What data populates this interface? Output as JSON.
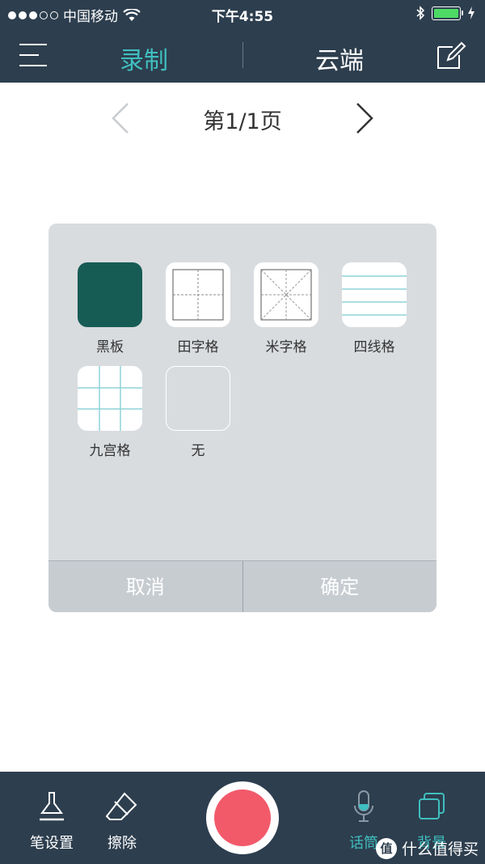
{
  "status": {
    "carrier": "中国移动",
    "time": "下午4:55"
  },
  "nav": {
    "tab_record": "录制",
    "tab_cloud": "云端"
  },
  "pager": {
    "label": "第1/1页"
  },
  "background_dialog": {
    "options": [
      {
        "label": "黑板",
        "icon": "blackboard-icon"
      },
      {
        "label": "田字格",
        "icon": "tian-grid-icon"
      },
      {
        "label": "米字格",
        "icon": "mi-grid-icon"
      },
      {
        "label": "四线格",
        "icon": "four-line-icon"
      },
      {
        "label": "九宫格",
        "icon": "nine-grid-icon"
      },
      {
        "label": "无",
        "icon": "none-icon"
      }
    ],
    "cancel": "取消",
    "confirm": "确定"
  },
  "toolbar": {
    "pen_settings": "笔设置",
    "eraser": "擦除",
    "mic": "话筒",
    "background": "背景",
    "watermark": "什么值得买",
    "watermark_badge": "值"
  },
  "colors": {
    "accent": "#3fbfbf",
    "bar": "#2d3e4e",
    "record": "#f25a6a",
    "blackboard": "#165c55"
  }
}
